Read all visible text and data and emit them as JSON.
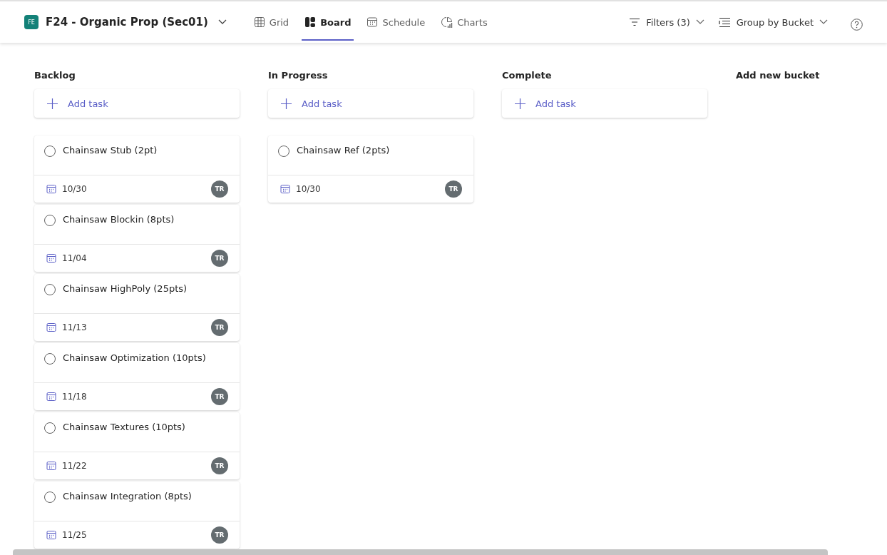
{
  "header": {
    "plan_badge": "FE",
    "plan_title": "F24 - Organic Prop (Sec01)",
    "tabs": [
      {
        "label": "Grid",
        "kind": "grid",
        "selected": false
      },
      {
        "label": "Board",
        "kind": "board",
        "selected": true
      },
      {
        "label": "Schedule",
        "kind": "schedule",
        "selected": false
      },
      {
        "label": "Charts",
        "kind": "charts",
        "selected": false
      }
    ],
    "filters": "Filters (3)",
    "group_by": "Group by Bucket"
  },
  "buckets": [
    {
      "name": "Backlog",
      "add_task": "Add task",
      "tasks": [
        {
          "title": "Chainsaw Stub (2pt)",
          "completed": false,
          "due": "10/30",
          "assignee": "TR"
        },
        {
          "title": "Chainsaw Blockin (8pts)",
          "completed": false,
          "due": "11/04",
          "assignee": "TR"
        },
        {
          "title": "Chainsaw HighPoly (25pts)",
          "completed": false,
          "due": "11/13",
          "assignee": "TR"
        },
        {
          "title": "Chainsaw Optimization (10pts)",
          "completed": false,
          "due": "11/18",
          "assignee": "TR"
        },
        {
          "title": "Chainsaw Textures (10pts)",
          "completed": false,
          "due": "11/22",
          "assignee": "TR"
        },
        {
          "title": "Chainsaw Integration (8pts)",
          "completed": false,
          "due": "11/25",
          "assignee": "TR"
        }
      ]
    },
    {
      "name": "In Progress",
      "add_task": "Add task",
      "tasks": [
        {
          "title": "Chainsaw Ref (2pts)",
          "completed": false,
          "due": "10/30",
          "assignee": "TR"
        }
      ]
    },
    {
      "name": "Complete",
      "add_task": "Add task"
    }
  ],
  "add_bucket": "Add new bucket"
}
